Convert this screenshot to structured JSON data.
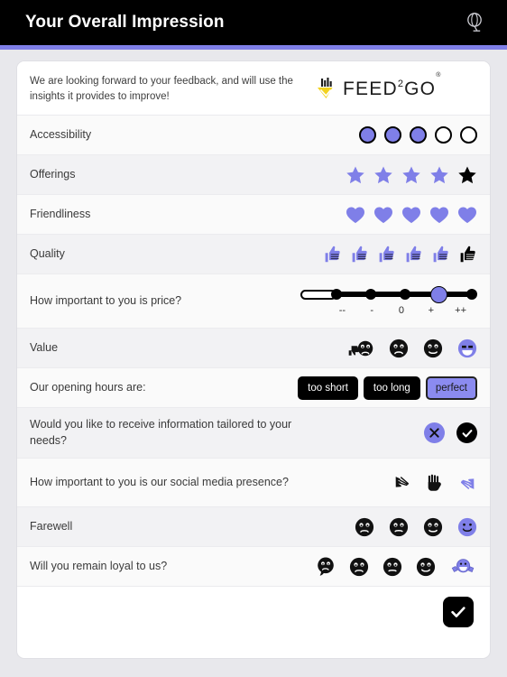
{
  "header": {
    "title": "Your Overall Impression",
    "language_icon": "globe-icon"
  },
  "accent_color": "#7f7fe8",
  "intro": {
    "text": "We are looking forward to your feedback, and will use the insights it provides to improve!",
    "logo_word": "FEED",
    "logo_sup": "2",
    "logo_word2": "GO",
    "logo_registered": "®"
  },
  "rows": [
    {
      "label": "Accessibility",
      "type": "circles",
      "total": 5,
      "selected": 3
    },
    {
      "label": "Offerings",
      "type": "stars",
      "total": 5,
      "selected": 4
    },
    {
      "label": "Friendliness",
      "type": "hearts",
      "total": 5,
      "selected": 5
    },
    {
      "label": "Quality",
      "type": "thumbs",
      "total": 6,
      "selected": 5
    },
    {
      "label": "How important to you is price?",
      "type": "slider",
      "ticks": [
        "--",
        "-",
        "0",
        "+",
        "++"
      ],
      "selected": 4
    },
    {
      "label": "Value",
      "type": "faces",
      "total": 4,
      "selected": 4
    },
    {
      "label": "Our opening hours are:",
      "type": "pills",
      "options": [
        "too short",
        "too long",
        "perfect"
      ],
      "selected": 3
    },
    {
      "label": "Would you like to receive information tailored to your needs?",
      "type": "yesno",
      "options": [
        "no",
        "yes"
      ],
      "selected": 1
    },
    {
      "label": "How important to you is our social media presence?",
      "type": "hands",
      "total": 3,
      "selected": 3
    },
    {
      "label": "Farewell",
      "type": "faces",
      "total": 4,
      "selected": 4
    },
    {
      "label": "Will you remain loyal to us?",
      "type": "faces-celebrate",
      "total": 5,
      "selected": 5
    }
  ],
  "submit": {
    "icon": "check-icon"
  }
}
